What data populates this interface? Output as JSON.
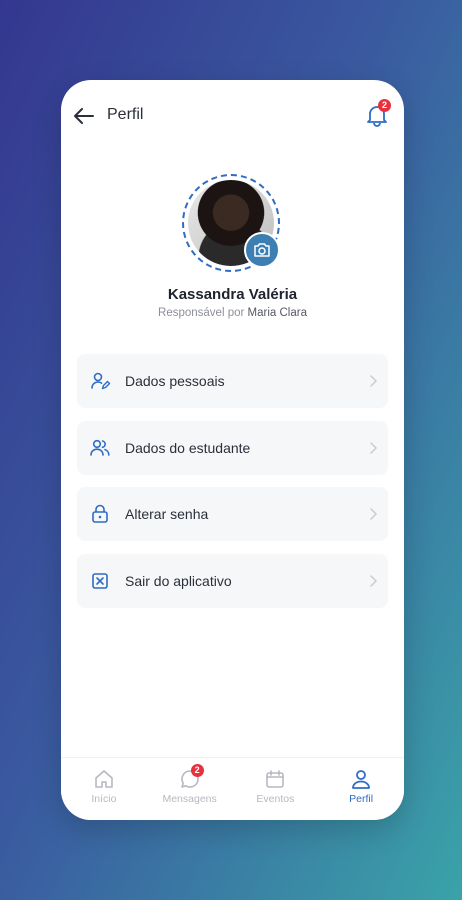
{
  "header": {
    "title": "Perfil",
    "notification_count": "2"
  },
  "profile": {
    "name": "Kassandra Valéria",
    "subtitle_prefix": "Responsável por",
    "responsible_for": "Maria Clara"
  },
  "menu": [
    {
      "label": "Dados pessoais",
      "icon": "user-edit-icon"
    },
    {
      "label": "Dados do estudante",
      "icon": "users-icon"
    },
    {
      "label": "Alterar senha",
      "icon": "lock-icon"
    },
    {
      "label": "Sair do aplicativo",
      "icon": "exit-icon"
    }
  ],
  "tabbar": {
    "items": [
      {
        "label": "Início",
        "icon": "home-icon"
      },
      {
        "label": "Mensagens",
        "icon": "message-icon",
        "badge": "2"
      },
      {
        "label": "Eventos",
        "icon": "calendar-icon"
      },
      {
        "label": "Perfil",
        "icon": "profile-icon",
        "active": true
      }
    ]
  },
  "colors": {
    "accent": "#2f6cc4",
    "badge": "#e8313c",
    "camera": "#3d7fb2"
  }
}
